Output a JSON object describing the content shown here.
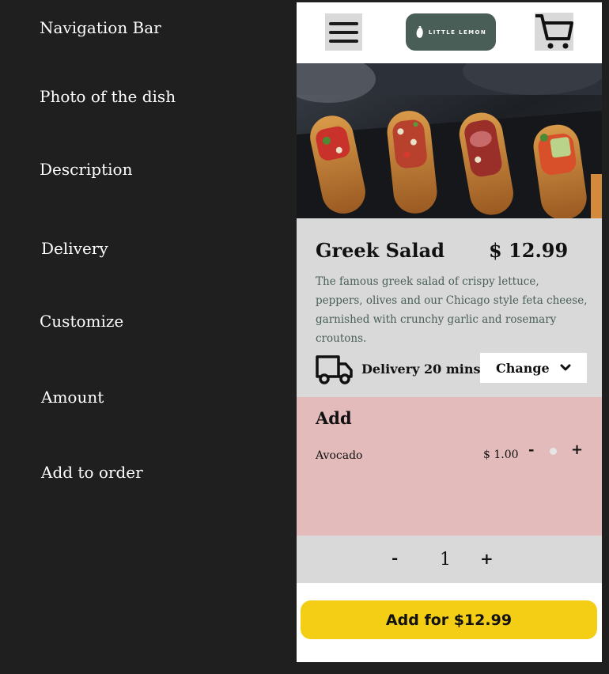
{
  "annotations": {
    "navigation_bar": "Navigation Bar",
    "photo": "Photo of the dish",
    "description": "Description",
    "delivery": "Delivery",
    "customize": "Customize",
    "amount": "Amount",
    "add_to_order": "Add to order"
  },
  "navbar": {
    "menu_icon": "hamburger-menu-icon",
    "logo_text": "LITTLE LEMON",
    "logo_icon": "lemon-icon",
    "cart_icon": "shopping-cart-icon"
  },
  "dish": {
    "title": "Greek Salad",
    "price": "$ 12.99",
    "description": "The famous greek salad of crispy lettuce, peppers, olives and our Chicago style feta cheese, garnished with crunchy garlic and rosemary croutons."
  },
  "delivery": {
    "icon": "truck-icon",
    "text": "Delivery 20 mins",
    "change_label": "Change",
    "chevron_icon": "chevron-down-icon"
  },
  "customize": {
    "heading": "Add",
    "options": [
      {
        "name": "Avocado",
        "price": "$ 1.00",
        "minus": "-",
        "plus": "+"
      }
    ]
  },
  "amount": {
    "minus": "-",
    "value": "1",
    "plus": "+"
  },
  "order_button": {
    "label": "Add for $12.99"
  },
  "colors": {
    "background": "#1f1f1f",
    "logo_green": "#495e57",
    "section_gray": "#d9d9d9",
    "customize_pink": "#e4bbbb",
    "button_yellow": "#f4ce14"
  }
}
